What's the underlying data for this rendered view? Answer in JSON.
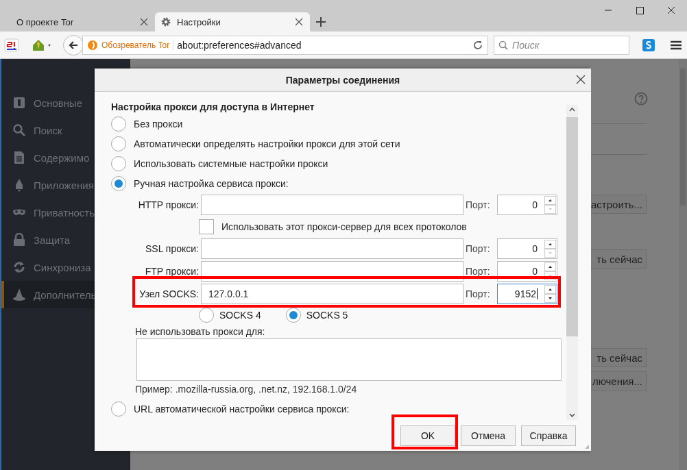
{
  "tabs": [
    {
      "title": "О проекте Tor",
      "selected": false
    },
    {
      "title": "Настройки",
      "selected": true
    }
  ],
  "toolbar": {
    "identity_label": "Обозреватель Tor",
    "url": "about:preferences#advanced",
    "search_placeholder": "Поиск"
  },
  "sidebar": {
    "items": [
      {
        "label": "Основные",
        "kind": "general",
        "selected": false
      },
      {
        "label": "Поиск",
        "kind": "search",
        "selected": false
      },
      {
        "label": "Содержимо",
        "kind": "content",
        "selected": false
      },
      {
        "label": "Приложения",
        "kind": "apps",
        "selected": false
      },
      {
        "label": "Приватность",
        "kind": "privacy",
        "selected": false
      },
      {
        "label": "Защита",
        "kind": "security",
        "selected": false
      },
      {
        "label": "Синхрониза",
        "kind": "sync",
        "selected": false
      },
      {
        "label": "Дополнитель",
        "kind": "advanced",
        "selected": true
      }
    ]
  },
  "page": {
    "buttons": [
      {
        "label": "астроить..."
      },
      {
        "label": "ть сейчас"
      },
      {
        "label": "ть сейчас"
      },
      {
        "label": "лючения..."
      }
    ]
  },
  "dialog": {
    "title": "Параметры соединения",
    "heading": "Настройка прокси для доступа в Интернет",
    "modes": [
      {
        "label": "Без прокси",
        "selected": false
      },
      {
        "label": "Автоматически определять настройки прокси для этой сети",
        "selected": false
      },
      {
        "label": "Использовать системные настройки прокси",
        "selected": false
      },
      {
        "label": "Ручная настройка сервиса прокси:",
        "selected": true
      }
    ],
    "rows": [
      {
        "kind": "proxy",
        "label": "HTTP прокси:",
        "port_label": "Порт:",
        "port": "0",
        "focused": false,
        "highlighted": false
      },
      {
        "kind": "checkbox",
        "label": "Использовать этот прокси-сервер для всех протоколов",
        "checked": false
      },
      {
        "kind": "proxy",
        "label": "SSL прокси:",
        "port_label": "Порт:",
        "port": "0",
        "focused": false,
        "highlighted": false
      },
      {
        "kind": "proxy",
        "label": "FTP прокси:",
        "port_label": "Порт:",
        "port": "0",
        "focused": false,
        "highlighted": false
      },
      {
        "kind": "proxy",
        "label": "Узел SOCKS:",
        "host": "127.0.0.1",
        "port_label": "Порт:",
        "port": "9152",
        "focused": true,
        "highlighted": true
      }
    ],
    "socks_versions": [
      {
        "label": "SOCKS 4",
        "selected": false
      },
      {
        "label": "SOCKS 5",
        "selected": true
      }
    ],
    "no_proxy_label": "Не использовать прокси для:",
    "example": "Пример: .mozilla-russia.org, .net.nz, 192.168.1.0/24",
    "pac_mode": {
      "label": "URL автоматической настройки сервиса прокси:",
      "selected": false
    },
    "buttons": [
      {
        "label": "OK",
        "highlighted": true
      },
      {
        "label": "Отмена",
        "highlighted": false
      },
      {
        "label": "Справка",
        "highlighted": false
      }
    ]
  }
}
